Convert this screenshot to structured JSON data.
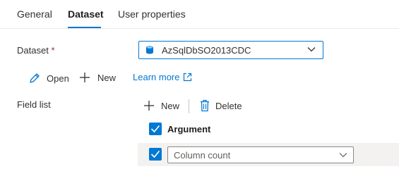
{
  "tabs": [
    {
      "label": "General"
    },
    {
      "label": "Dataset"
    },
    {
      "label": "User properties"
    }
  ],
  "dataset": {
    "label": "Dataset",
    "required_mark": "*",
    "selected_value": "AzSqlDbSO2013CDC",
    "icon": "sql-database-icon"
  },
  "dataset_actions": {
    "open_label": "Open",
    "new_label": "New",
    "learn_more_label": "Learn more"
  },
  "field_list": {
    "label": "Field list",
    "new_label": "New",
    "delete_label": "Delete",
    "header_checked": true,
    "header_label": "Argument",
    "rows": [
      {
        "checked": true,
        "value": "Column count"
      }
    ]
  },
  "colors": {
    "accent": "#0078d4",
    "required": "#a4262c",
    "row_background": "#f3f2f1"
  }
}
